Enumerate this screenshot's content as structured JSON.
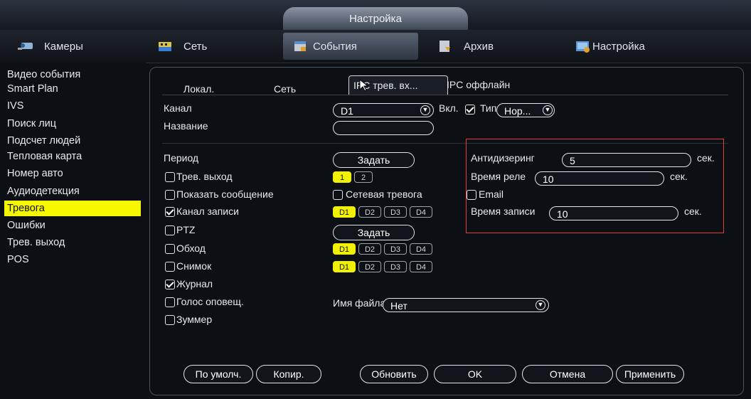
{
  "window_title": "Настройка",
  "topnav": [
    {
      "label": "Камеры",
      "icon": "camera-icon"
    },
    {
      "label": "Сеть",
      "icon": "network-icon"
    },
    {
      "label": "События",
      "icon": "events-icon"
    },
    {
      "label": "Архив",
      "icon": "archive-icon"
    },
    {
      "label": "Настройка",
      "icon": "settings-icon"
    }
  ],
  "sidebar": [
    "Видео события",
    "Smart Plan",
    "IVS",
    "Поиск лиц",
    "Подсчет людей",
    "Тепловая карта",
    "Номер авто",
    "Аудиодетекция",
    "Тревога",
    "Ошибки",
    "Трев. выход",
    "POS"
  ],
  "tabs": [
    "Локал.",
    "Сеть",
    "IPC трев. вх...",
    "IPC оффлайн"
  ],
  "form": {
    "channel_label": "Канал",
    "channel_value": "D1",
    "enable_label": "Вкл.",
    "type_label": "Тип",
    "type_value": "Нор...",
    "name_label": "Название",
    "name_value": "",
    "period_label": "Период",
    "period_button": "Задать",
    "alarm_out_label": "Трев. выход",
    "alarm_out_chips": [
      "1",
      "2"
    ],
    "show_message_label": "Показать сообщение",
    "net_alarm_label": "Сетевая тревога",
    "email_label": "Email",
    "record_channel_label": "Канал записи",
    "record_chips": [
      "D1",
      "D2",
      "D3",
      "D4"
    ],
    "ptz_label": "PTZ",
    "ptz_button": "Задать",
    "tour_label": "Обход",
    "tour_chips": [
      "D1",
      "D2",
      "D3",
      "D4"
    ],
    "snapshot_label": "Снимок",
    "snapshot_chips": [
      "D1",
      "D2",
      "D3",
      "D4"
    ],
    "log_label": "Журнал",
    "voice_label": "Голос оповещ.",
    "filename_label": "Имя файла",
    "filename_value": "Нет",
    "buzzer_label": "Зуммер",
    "antidither_label": "Антидизеринг",
    "antidither_value": "5",
    "relay_time_label": "Время реле",
    "relay_time_value": "10",
    "record_time_label": "Время записи",
    "record_time_value": "10",
    "sec_unit": "сек."
  },
  "footer": {
    "default": "По умолч.",
    "copy": "Копир.",
    "refresh": "Обновить",
    "ok": "OK",
    "cancel": "Отмена",
    "apply": "Применить"
  },
  "colors": {
    "accent_yellow": "#f2f200",
    "highlight_red": "#e23b3b"
  }
}
